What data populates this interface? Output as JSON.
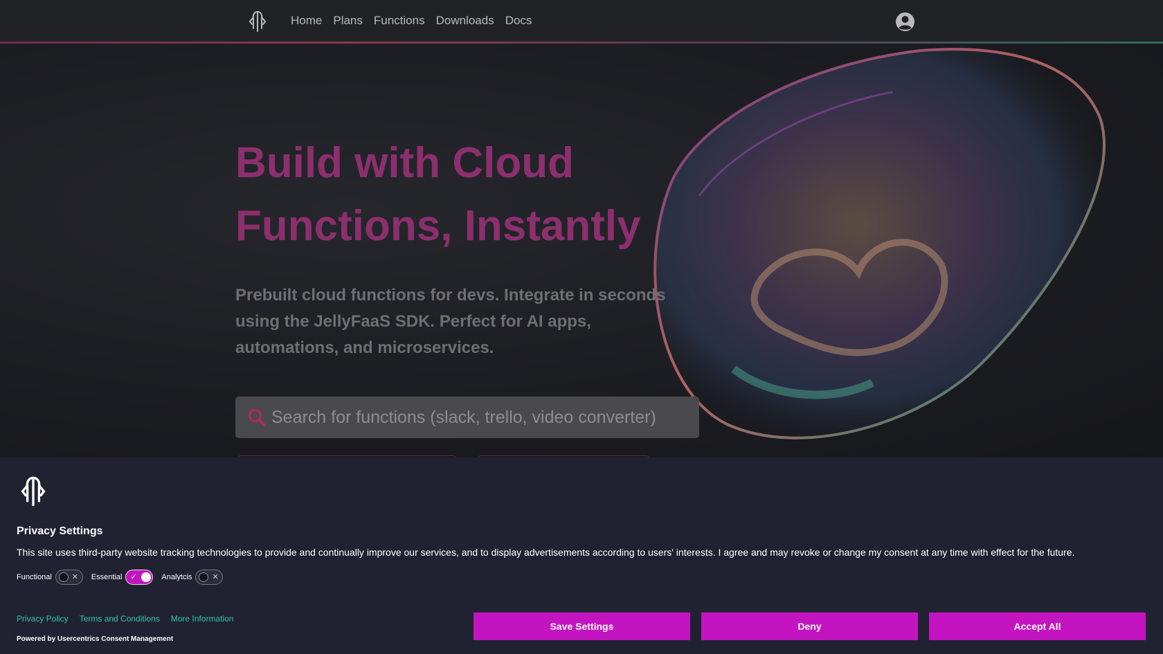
{
  "nav": {
    "logo_icon": "jellyfish-logo-icon",
    "items": [
      {
        "label": "Home"
      },
      {
        "label": "Plans"
      },
      {
        "label": "Functions"
      },
      {
        "label": "Downloads"
      },
      {
        "label": "Docs"
      }
    ],
    "account_icon": "user-circle-icon"
  },
  "hero": {
    "title": "Build with Cloud Functions, Instantly",
    "subtitle": "Prebuilt cloud functions for devs. Integrate in seconds using the JellyFaaS SDK. Perfect for AI apps, automations, and microservices.",
    "search": {
      "placeholder": "Search for functions (slack, trello, video converter)",
      "icon": "search-icon"
    }
  },
  "consent": {
    "logo_icon": "jellyfish-logo-icon",
    "title": "Privacy Settings",
    "text": "This site uses third-party website tracking technologies to provide and continually improve our services, and to display advertisements according to users' interests. I agree and may revoke or change my consent at any time with effect for the future.",
    "toggles": [
      {
        "label": "Functional",
        "state": "off"
      },
      {
        "label": "Essential",
        "state": "on"
      },
      {
        "label": "Analytcis",
        "state": "off"
      }
    ],
    "links": [
      {
        "label": "Privacy Policy"
      },
      {
        "label": "Terms and Conditions"
      },
      {
        "label": "More Information"
      }
    ],
    "powered_by": "Powered by Usercentrics Consent Management",
    "buttons": {
      "save": "Save Settings",
      "deny": "Deny",
      "accept": "Accept All"
    },
    "accent_color": "#c414c2",
    "link_color": "#2fc3b0"
  }
}
